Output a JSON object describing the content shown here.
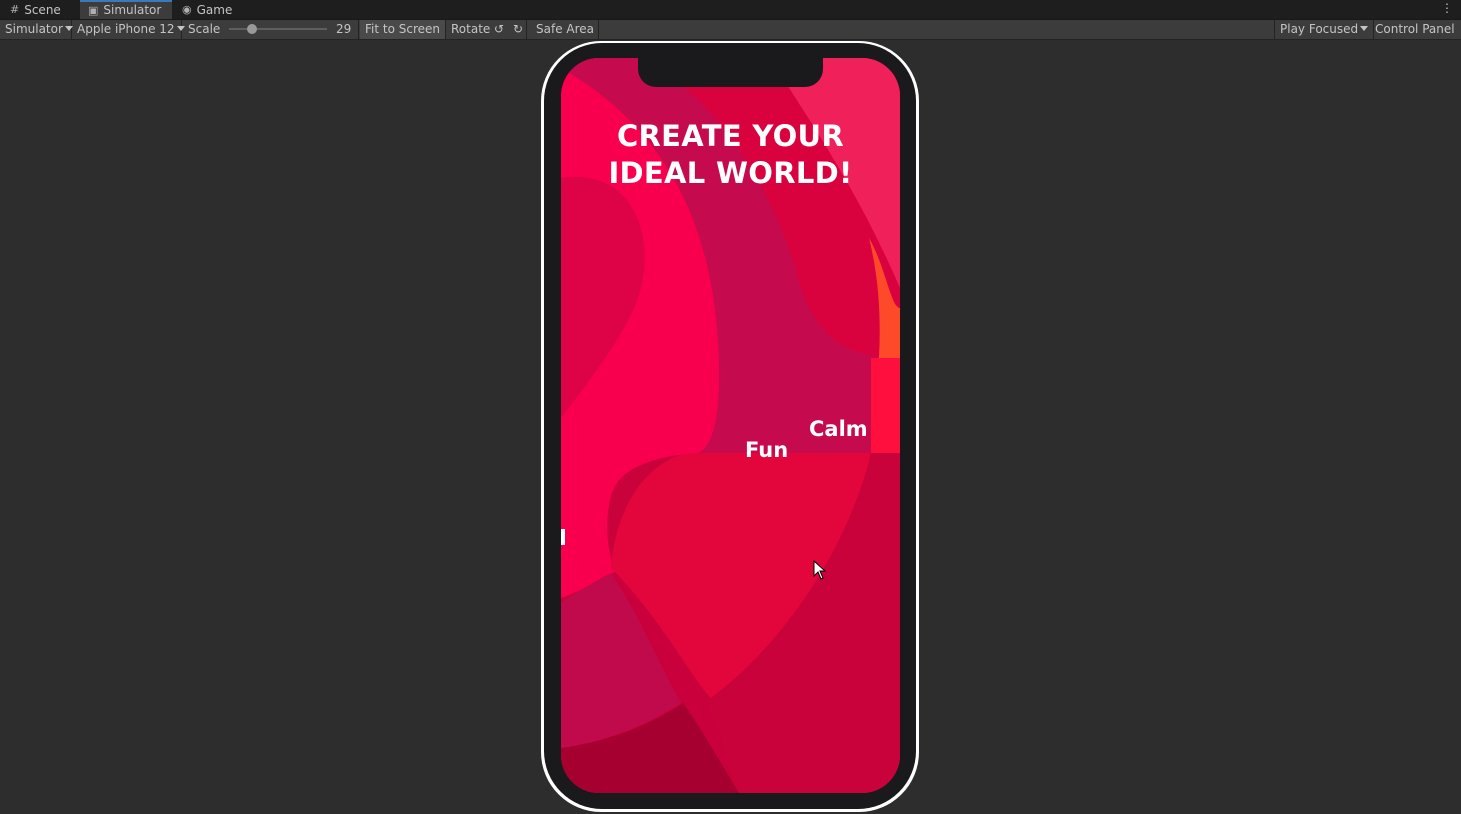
{
  "tabs": [
    {
      "label": "Scene",
      "icon": "grid-icon"
    },
    {
      "label": "Simulator",
      "icon": "simulator-icon",
      "active": true
    },
    {
      "label": "Game",
      "icon": "gamepad-icon"
    }
  ],
  "toolbar": {
    "mode": "Simulator",
    "device": "Apple iPhone 12",
    "scale_label": "Scale",
    "scale_value": "29",
    "fit_to_screen": "Fit to Screen",
    "rotate": "Rotate",
    "safe_area": "Safe Area",
    "play_focused": "Play Focused",
    "control_panel": "Control Panel"
  },
  "game": {
    "title_line1": "CREATE YOUR",
    "title_line2": "IDEAL WORLD!",
    "option_fun": "Fun",
    "option_calm": "Calm"
  },
  "colors": {
    "editor_bg": "#2d2d2d",
    "screen_base": "#f8004e",
    "accent_tab": "#3a79bb"
  }
}
